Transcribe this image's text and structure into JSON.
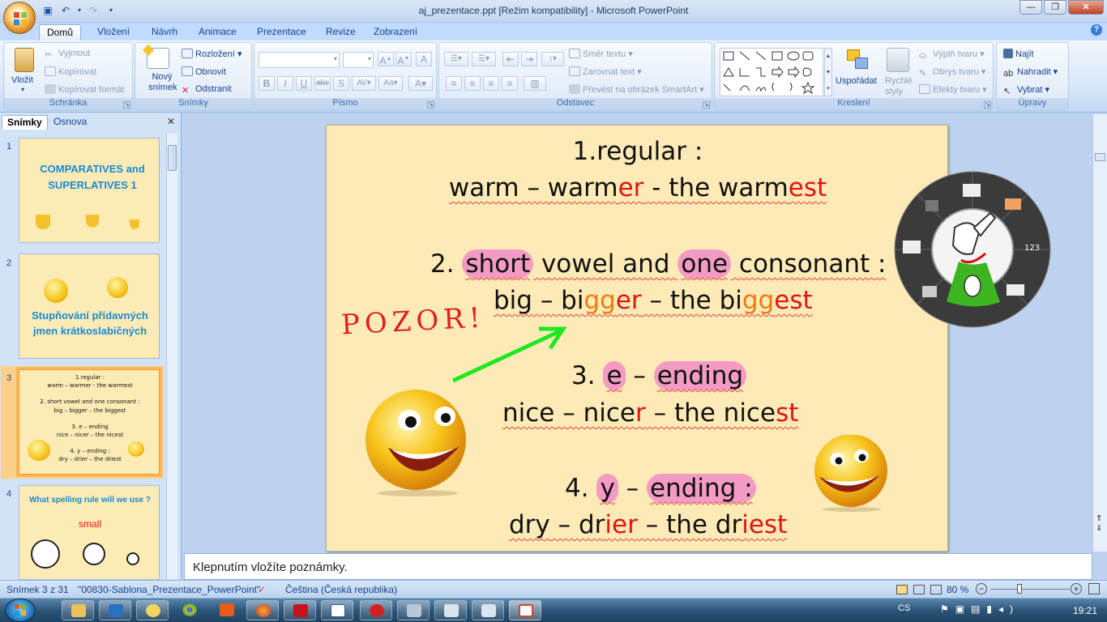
{
  "window": {
    "title": "aj_prezentace.ppt [Režim kompatibility] - Microsoft PowerPoint"
  },
  "tabs": [
    "Domů",
    "Vložení",
    "Návrh",
    "Animace",
    "Prezentace",
    "Revize",
    "Zobrazení"
  ],
  "ribbon": {
    "clipboard": {
      "label": "Schránka",
      "paste": "Vložit",
      "cut": "Vyjmout",
      "copy": "Kopírovat",
      "format": "Kopírovat formát"
    },
    "slides": {
      "label": "Snímky",
      "new_slide": "Nový snímek",
      "layout": "Rozložení",
      "reset": "Obnovit",
      "delete": "Odstranit"
    },
    "font": {
      "label": "Písmo"
    },
    "paragraph": {
      "label": "Odstavec",
      "direction": "Směr textu",
      "align": "Zarovnat text",
      "smartart": "Převést na obrázek SmartArt"
    },
    "drawing": {
      "label": "Kreslení",
      "arrange": "Uspořádat",
      "quick_styles": "Rychlé styly",
      "fill": "Výplň tvaru",
      "outline": "Obrys tvaru",
      "effects": "Efekty tvaru"
    },
    "editing": {
      "label": "Úpravy",
      "find": "Najít",
      "replace": "Nahradit",
      "select": "Vybrat"
    }
  },
  "left_panel": {
    "tab_slides": "Snímky",
    "tab_outline": "Osnova",
    "thumbnails": [
      {
        "num": "1",
        "title": "COMPARATIVES and SUPERLATIVES 1"
      },
      {
        "num": "2",
        "title": "Stupňování přídavných jmen krátkoslabičných"
      },
      {
        "num": "3",
        "lines": [
          "1.regular :",
          "warm – warmer - the warmest",
          "2. short vowel and one consonant :",
          "big – bigger – the biggest",
          "3. e – ending",
          "nice – nicer – the nicest",
          "4. y – ending :",
          "dry – drier – the driest"
        ]
      },
      {
        "num": "4",
        "title": "What spelling rule will we use ?",
        "word": "small"
      }
    ]
  },
  "slide": {
    "l1": "1.regular :",
    "l2": {
      "a": "warm",
      "b": " – warm",
      "c": "er",
      "d": " - the warm",
      "e": "est"
    },
    "l3": {
      "a": "2. ",
      "b": "short",
      "c": " vowel and ",
      "d": "one",
      "e": " consonant :"
    },
    "l4": {
      "a": "big",
      "b": " – bi",
      "c": "gg",
      "d": "er",
      "e": " – the bi",
      "f": "gg",
      "g": "est"
    },
    "l5": {
      "a": "3. ",
      "b": "e",
      "c": " – ",
      "d": "ending"
    },
    "l6": {
      "a": "nice",
      "b": " – nice",
      "c": "r",
      "d": " – the nice",
      "e": "st"
    },
    "l7": {
      "a": "4. ",
      "b": "y",
      "c": " – ",
      "d": "ending :"
    },
    "l8": {
      "a": "dry",
      "b": " – dr",
      "c": "ier",
      "d": " – the dr",
      "e": "iest"
    },
    "handwriting": "POZOR!"
  },
  "notes_placeholder": "Klepnutím vložíte poznámky.",
  "status": {
    "slide": "Snímek 3 z 31",
    "template": "\"00830-Sablona_Prezentace_PowerPoint\"",
    "language": "Čeština (Česká republika)",
    "zoom": "80 %"
  },
  "taskbar": {
    "lang": "CS",
    "time": "19:21"
  }
}
